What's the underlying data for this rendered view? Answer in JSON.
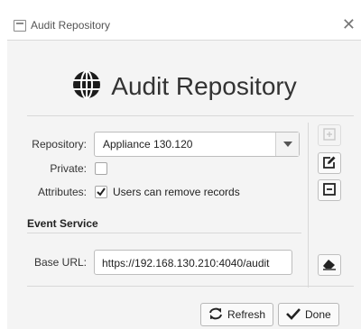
{
  "window": {
    "title": "Audit Repository"
  },
  "header": {
    "icon": "globe-icon",
    "title": "Audit Repository"
  },
  "form": {
    "repository_label": "Repository:",
    "repository_value": "Appliance 130.120",
    "private_label": "Private:",
    "private_checked": false,
    "attributes_label": "Attributes:",
    "attributes_checked": true,
    "attributes_option": "Users can remove records",
    "event_service_title": "Event Service",
    "base_url_label": "Base URL:",
    "base_url_value": "https://192.168.130.210:4040/audit"
  },
  "side_buttons": [
    {
      "name": "add-button",
      "icon": "plus-square-icon",
      "enabled": false
    },
    {
      "name": "edit-button",
      "icon": "edit-icon",
      "enabled": true
    },
    {
      "name": "remove-button",
      "icon": "minus-square-icon",
      "enabled": true
    },
    {
      "name": "clear-button",
      "icon": "eraser-icon",
      "enabled": true
    }
  ],
  "footer": {
    "refresh_label": "Refresh",
    "done_label": "Done"
  }
}
